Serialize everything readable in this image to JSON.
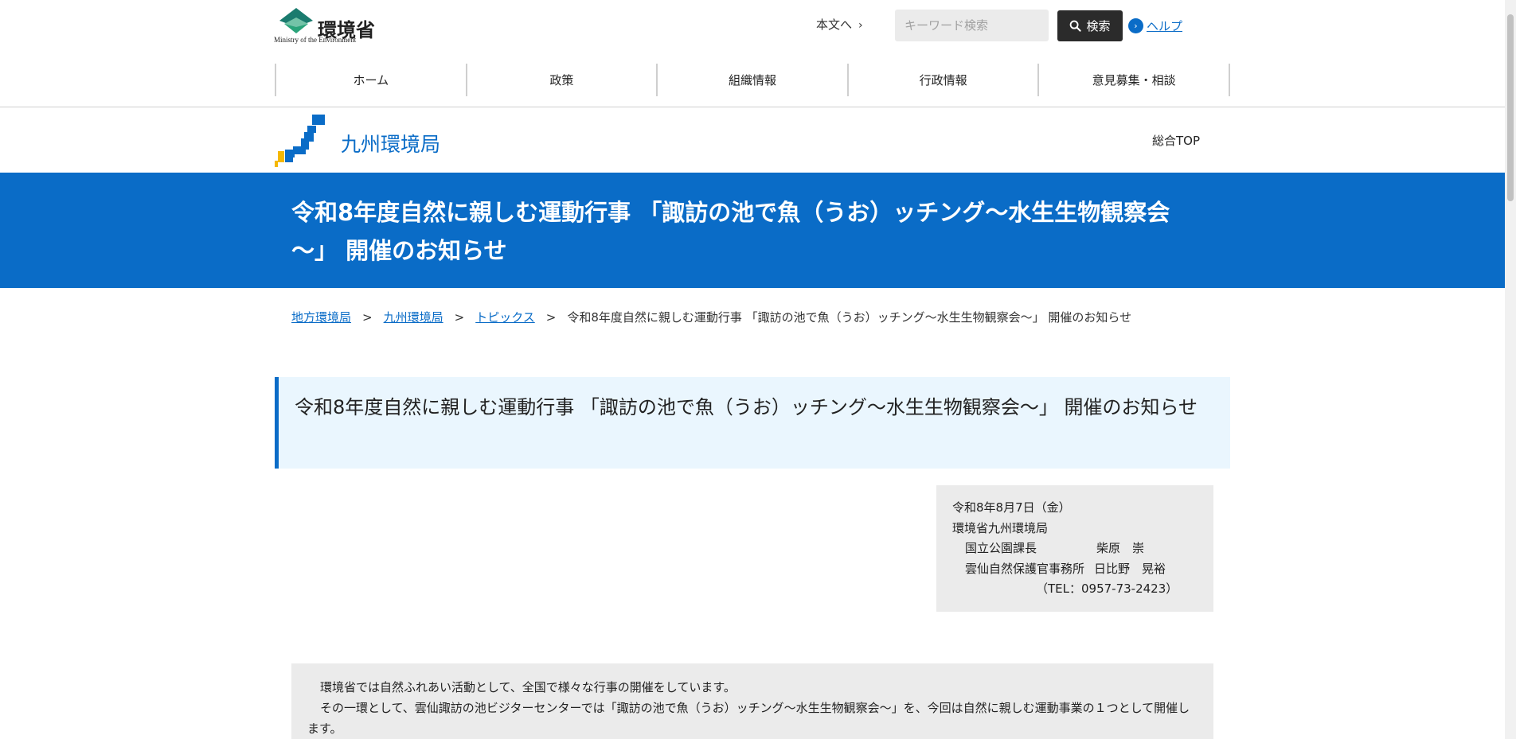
{
  "header": {
    "logo_jp": "環境省",
    "logo_en": "Ministry of the Environment",
    "skip_label": "本文へ",
    "search_placeholder": "キーワード検索",
    "search_button": "検索",
    "help_label": "ヘルプ"
  },
  "nav": {
    "items": [
      "ホーム",
      "政策",
      "組織情報",
      "行政情報",
      "意見募集・相談"
    ]
  },
  "region": {
    "name": "九州環境局",
    "top_link": "総合TOP"
  },
  "hero": {
    "title": "令和8年度自然に親しむ運動行事 「諏訪の池で魚（うお）ッチング～水生生物観察会～」 開催のお知らせ"
  },
  "breadcrumb": {
    "items": [
      "地方環境局",
      "九州環境局",
      "トピックス"
    ],
    "current": "令和8年度自然に親しむ運動行事 「諏訪の池で魚（うお）ッチング～水生生物観察会～」 開催のお知らせ",
    "separator": ">"
  },
  "page": {
    "title": "令和8年度自然に親しむ運動行事 「諏訪の池で魚（うお）ッチング～水生生物観察会～」 開催のお知らせ"
  },
  "info": {
    "date": "令和8年8月7日（金）",
    "org": "環境省九州環境局",
    "dept1": "国立公園課長",
    "person1": "柴原　崇",
    "dept2": "雲仙自然保護官事務所",
    "person2": "日比野　晃裕",
    "tel": "（TEL：0957-73-2423）"
  },
  "body": {
    "para1": "環境省では自然ふれあい活動として、全国で様々な行事の開催をしています。",
    "para2": "その一環として、雲仙諏訪の池ビジターセンターでは「諏訪の池で魚（うお）ッチング～水生生物観察会～」を、今回は自然に親しむ運動事業の１つとして開催します。"
  },
  "colors": {
    "brand_blue": "#0a6cc7",
    "title_bg": "#eaf6fe",
    "box_bg": "#ebebeb",
    "search_btn": "#2b2b2b",
    "map_yellow": "#f5b800"
  }
}
